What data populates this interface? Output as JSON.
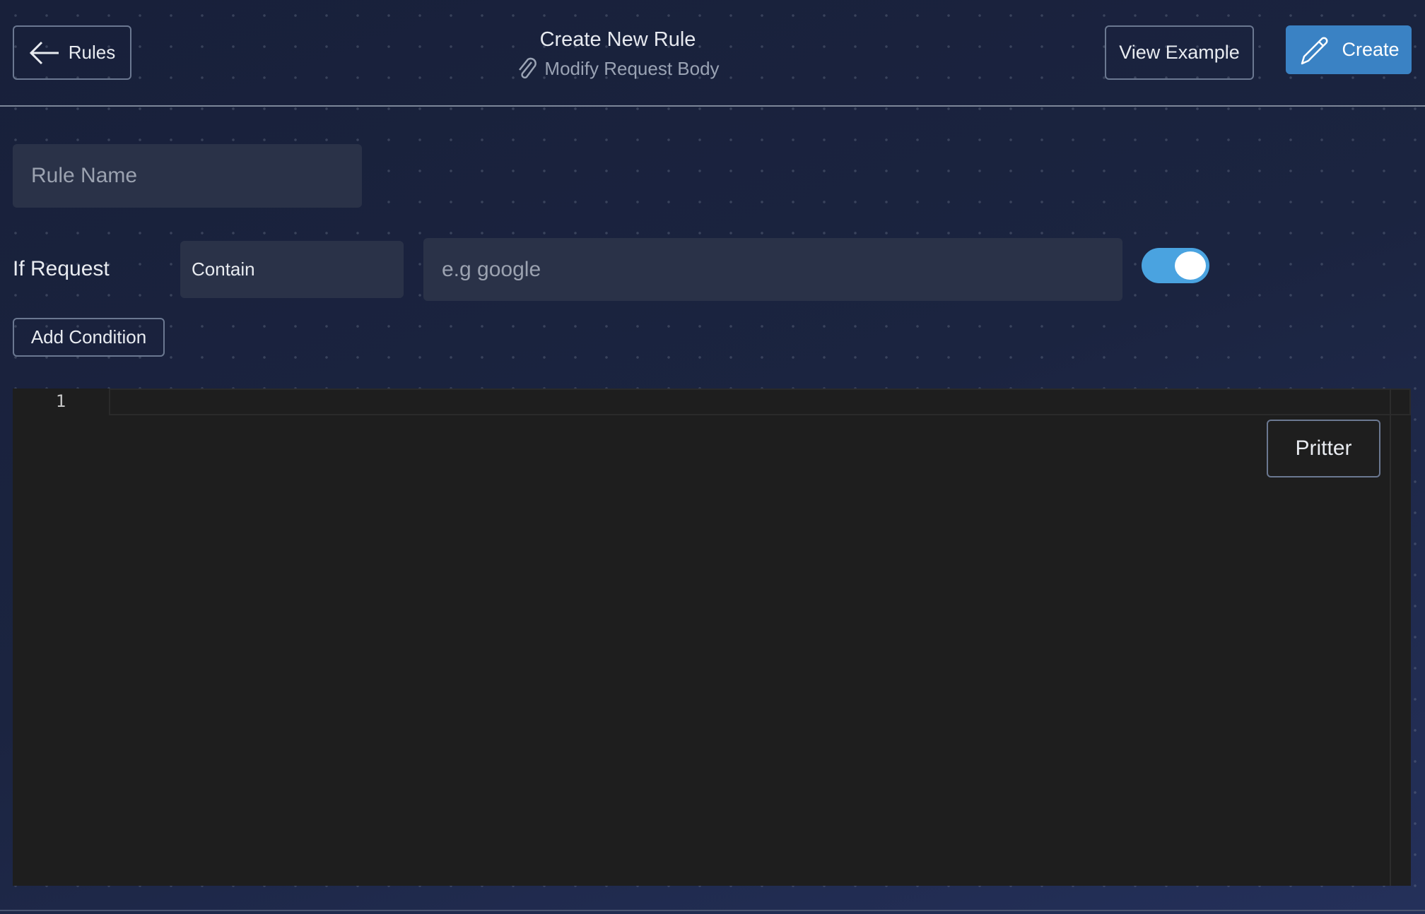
{
  "header": {
    "back_label": "Rules",
    "title": "Create New Rule",
    "subtitle": "Modify Request Body",
    "view_example_label": "View Example",
    "create_label": "Create"
  },
  "form": {
    "rule_name_placeholder": "Rule Name",
    "if_request_label": "If Request",
    "operator_value": "Contain",
    "url_placeholder": "e.g google",
    "toggle_on": true,
    "add_condition_label": "Add Condition"
  },
  "editor": {
    "line_numbers": [
      "1"
    ],
    "format_button_label": "Pritter"
  },
  "colors": {
    "accent": "#3b82c4",
    "toggle": "#4aa3e0",
    "editor_bg": "#1e1e1e"
  }
}
